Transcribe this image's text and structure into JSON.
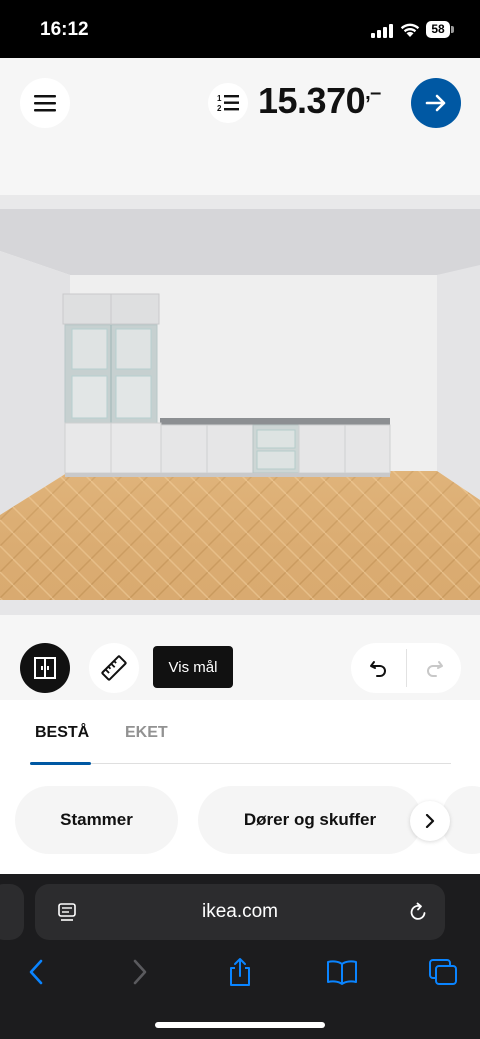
{
  "status_bar": {
    "time": "16:12",
    "battery": "58",
    "icons": [
      "cellular-signal-icon",
      "wifi-icon",
      "battery-icon"
    ]
  },
  "header": {
    "menu_icon": "hamburger-menu-icon",
    "list_icon": "numbered-list-icon",
    "price": "15.370",
    "price_suffix": ",–",
    "next_icon": "arrow-right-icon",
    "accent_color": "#0058a3"
  },
  "toolbar": {
    "view_icon": "cabinet-doors-icon",
    "ruler_icon": "ruler-icon",
    "show_measurements_label": "Vis mål",
    "undo_icon": "undo-icon",
    "redo_icon": "redo-icon"
  },
  "sheet": {
    "tabs": [
      {
        "label": "BESTÅ",
        "active": true
      },
      {
        "label": "EKET",
        "active": false
      }
    ],
    "chips": [
      {
        "label": "Stammer"
      },
      {
        "label": "Dører og skuffer"
      }
    ],
    "chip_next_icon": "chevron-right-icon"
  },
  "browser": {
    "url": "ikea.com",
    "reader_icon": "page-menu-icon",
    "reload_icon": "reload-icon",
    "nav": [
      "back-icon",
      "forward-icon",
      "share-icon",
      "bookmarks-icon",
      "tabs-icon"
    ]
  }
}
